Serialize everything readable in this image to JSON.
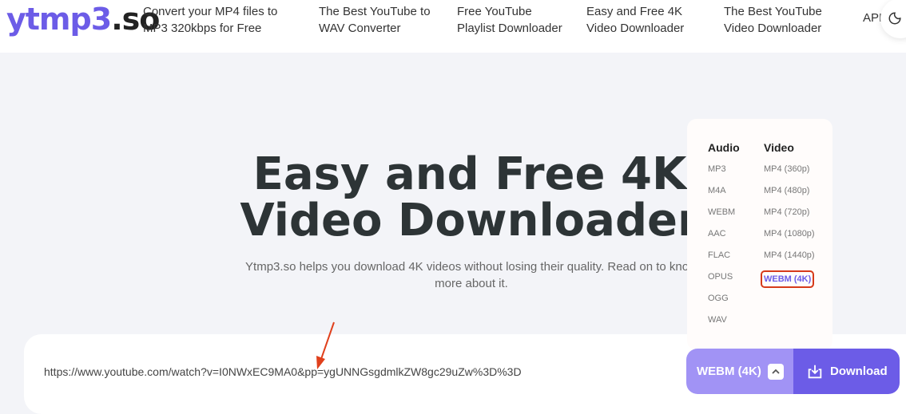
{
  "header": {
    "logo_a": "ytmp3",
    "logo_b": ".so",
    "nav": [
      "Convert your MP4 files to MP3 320kbps for Free",
      "The Best YouTube to WAV Converter",
      "Free YouTube Playlist Downloader",
      "Easy and Free 4K Video Downloader",
      "The Best YouTube Video Downloader"
    ],
    "api": "API",
    "theme_icon": "moon-icon"
  },
  "hero": {
    "title_line1": "Easy and Free 4K",
    "title_line2": "Video Downloader",
    "subtitle": "Ytmp3.so helps you download 4K videos without losing their quality. Read on to know more about it."
  },
  "dropdown": {
    "audio_label": "Audio",
    "video_label": "Video",
    "audio": [
      "MP3",
      "M4A",
      "WEBM",
      "AAC",
      "FLAC",
      "OPUS",
      "OGG",
      "WAV"
    ],
    "video": [
      "MP4 (360p)",
      "MP4 (480p)",
      "MP4 (720p)",
      "MP4 (1080p)",
      "MP4 (1440p)",
      "WEBM (4K)"
    ],
    "selected": "WEBM (4K)"
  },
  "input": {
    "value": "https://www.youtube.com/watch?v=I0NWxEC9MA0&pp=ygUNNGsgdmlkZW8gc29uZw%3D%3D"
  },
  "actions": {
    "format": "WEBM (4K)",
    "download": "Download"
  },
  "colors": {
    "accent": "#6c5ce7",
    "accent_light": "#a193f5",
    "highlight": "#d63a1a"
  }
}
